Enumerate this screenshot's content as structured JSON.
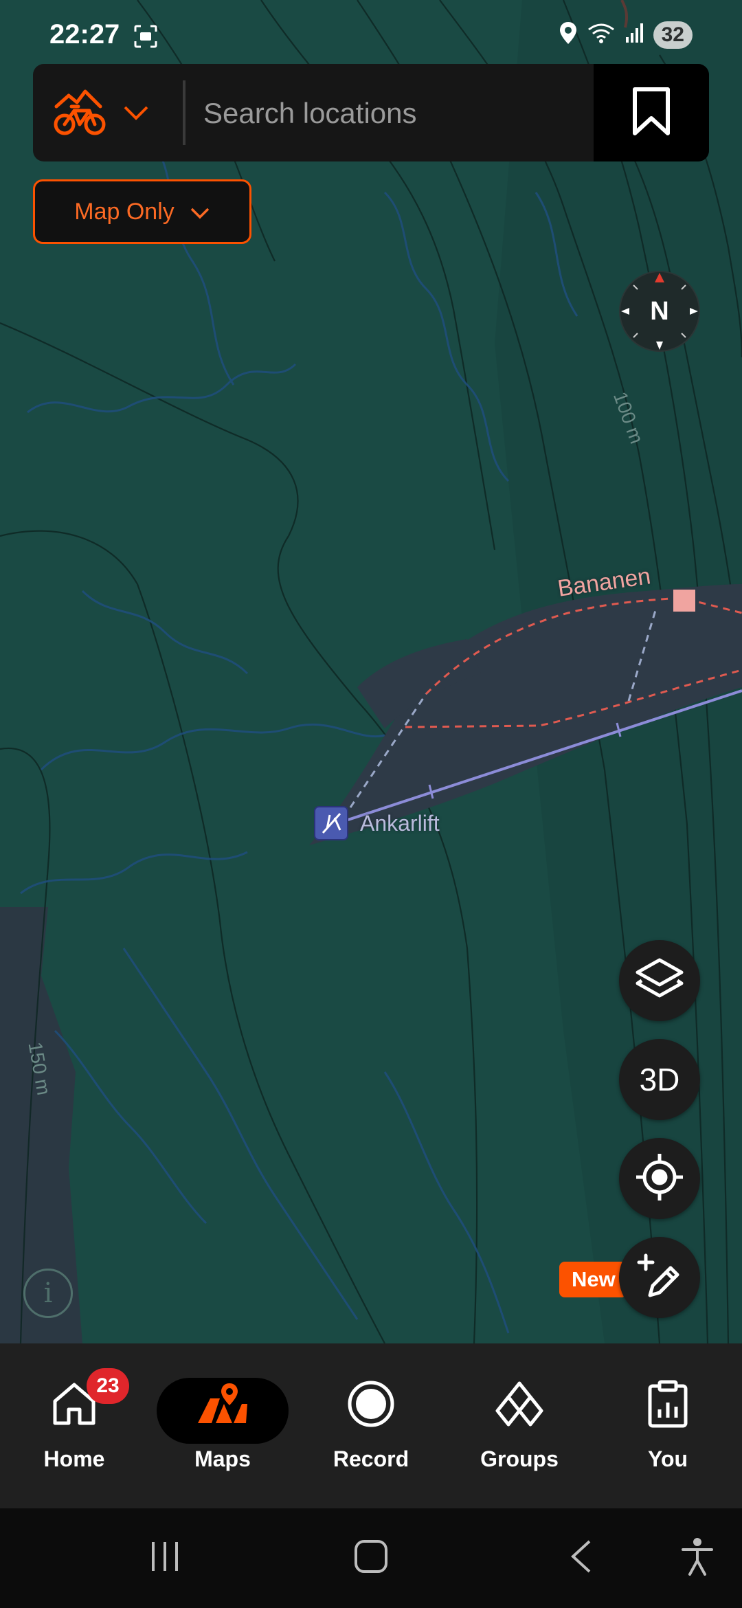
{
  "status_bar": {
    "time": "22:27",
    "battery": "32",
    "left_icons": [
      "screenshot-icon"
    ],
    "right_icons": [
      "location-icon",
      "wifi-icon",
      "signal-icon",
      "battery-icon"
    ]
  },
  "search": {
    "placeholder": "Search locations",
    "sport_icon": "mountain-bike-icon",
    "bookmark_icon": "bookmark-icon"
  },
  "map_filter": {
    "label": "Map Only"
  },
  "map": {
    "labels": {
      "lift1": "Ankarlift",
      "lift2": "Bananen",
      "contour1": "100 m",
      "contour2": "150 m"
    },
    "compass_label": "N"
  },
  "fab": {
    "layers_icon": "layers-icon",
    "three_d": "3D",
    "locate_icon": "crosshair-icon",
    "new_badge": "New",
    "route_icon": "draw-route-icon"
  },
  "info_label": "i",
  "nav": {
    "items": [
      {
        "label": "Home",
        "icon": "home-icon",
        "badge": "23"
      },
      {
        "label": "Maps",
        "icon": "maps-icon",
        "active": true
      },
      {
        "label": "Record",
        "icon": "record-icon"
      },
      {
        "label": "Groups",
        "icon": "groups-icon"
      },
      {
        "label": "You",
        "icon": "you-icon"
      }
    ]
  },
  "colors": {
    "accent": "#fc5200",
    "map_background": "#1a4a44",
    "piste_area": "#2e3a47",
    "lift_line": "#8c8cd8",
    "route_dashed": "#e05a50",
    "nav_background": "#202020"
  }
}
